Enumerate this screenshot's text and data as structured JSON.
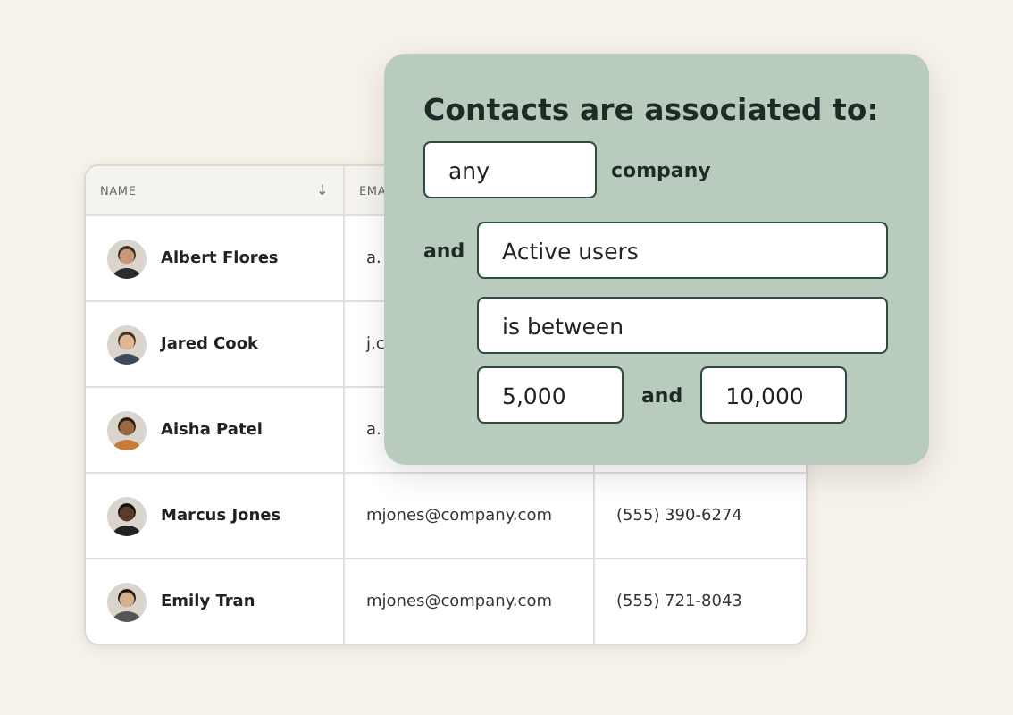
{
  "table": {
    "columns": [
      {
        "label": "NAME",
        "sort_icon": "↓"
      },
      {
        "label": "EMA"
      }
    ],
    "rows": [
      {
        "name": "Albert Flores",
        "email": "a."
      },
      {
        "name": "Jared Cook",
        "email": "j.c"
      },
      {
        "name": "Aisha Patel",
        "email": "a."
      },
      {
        "name": "Marcus Jones",
        "email": "mjones@company.com",
        "phone": "(555) 390-6274"
      },
      {
        "name": "Emily Tran",
        "email": "mjones@company.com",
        "phone": "(555) 721-8043"
      }
    ]
  },
  "filter": {
    "title": "Contacts are associated to:",
    "scope": {
      "value": "any",
      "suffix": "company"
    },
    "conjunction": "and",
    "property": {
      "value": "Active users"
    },
    "operator": {
      "value": "is between"
    },
    "range": {
      "from": "5,000",
      "joiner": "and",
      "to": "10,000"
    }
  }
}
